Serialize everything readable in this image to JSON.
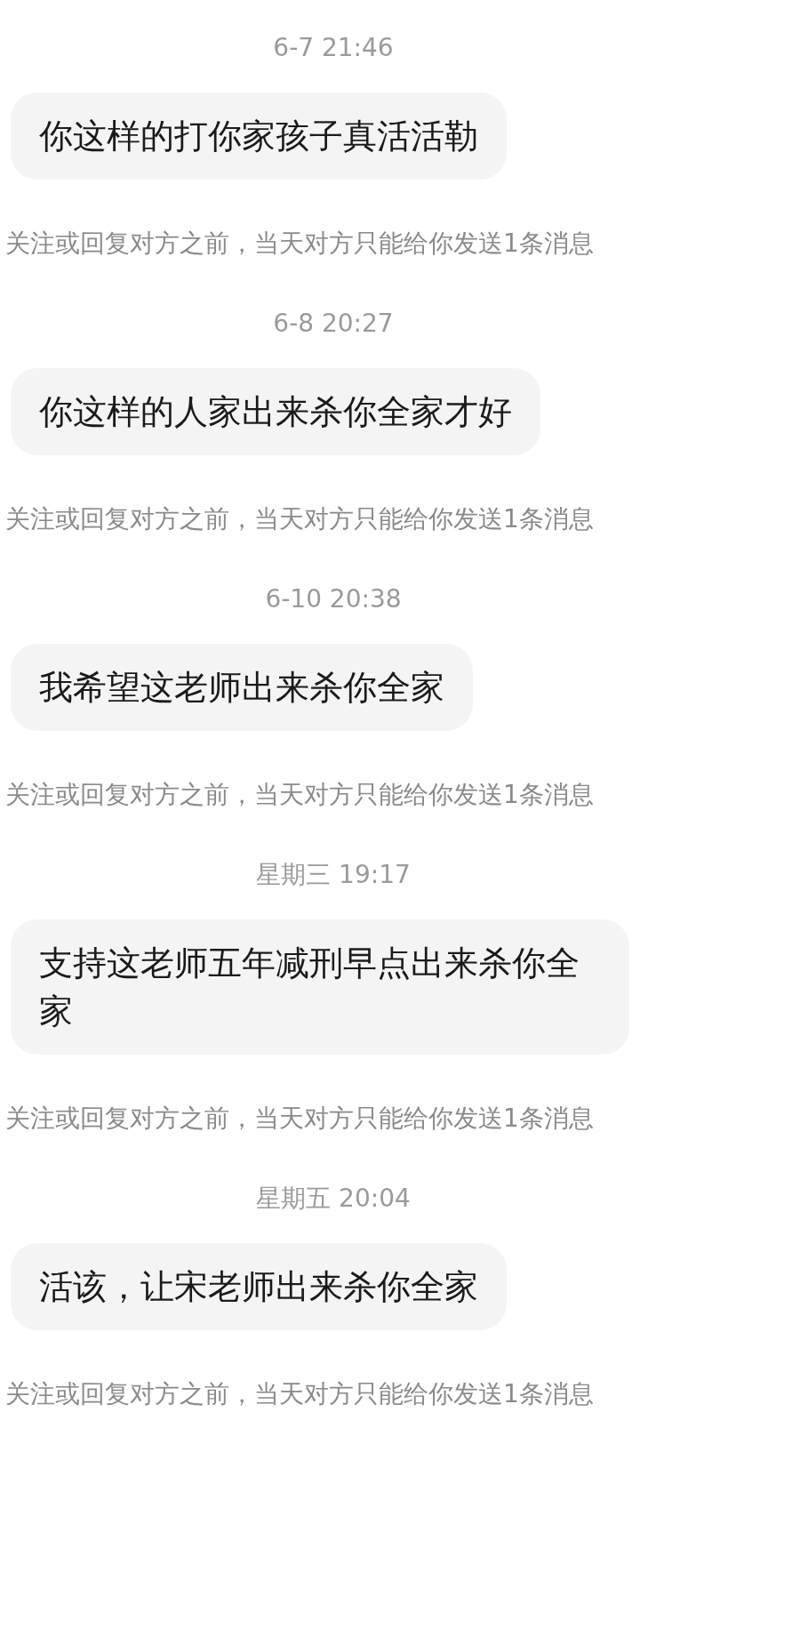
{
  "messages": [
    {
      "time": "6-7 21:46",
      "text": "你这样的打你家孩子真活活勒",
      "notice": "关注或回复对方之前，当天对方只能给你发送1条消息"
    },
    {
      "time": "6-8 20:27",
      "text": "你这样的人家出来杀你全家才好",
      "notice": "关注或回复对方之前，当天对方只能给你发送1条消息"
    },
    {
      "time": "6-10 20:38",
      "text": "我希望这老师出来杀你全家",
      "notice": "关注或回复对方之前，当天对方只能给你发送1条消息"
    },
    {
      "time": "星期三 19:17",
      "text": "支持这老师五年减刑早点出来杀你全家",
      "notice": "关注或回复对方之前，当天对方只能给你发送1条消息"
    },
    {
      "time": "星期五 20:04",
      "text": "活该，让宋老师出来杀你全家",
      "notice": "关注或回复对方之前，当天对方只能给你发送1条消息"
    }
  ]
}
